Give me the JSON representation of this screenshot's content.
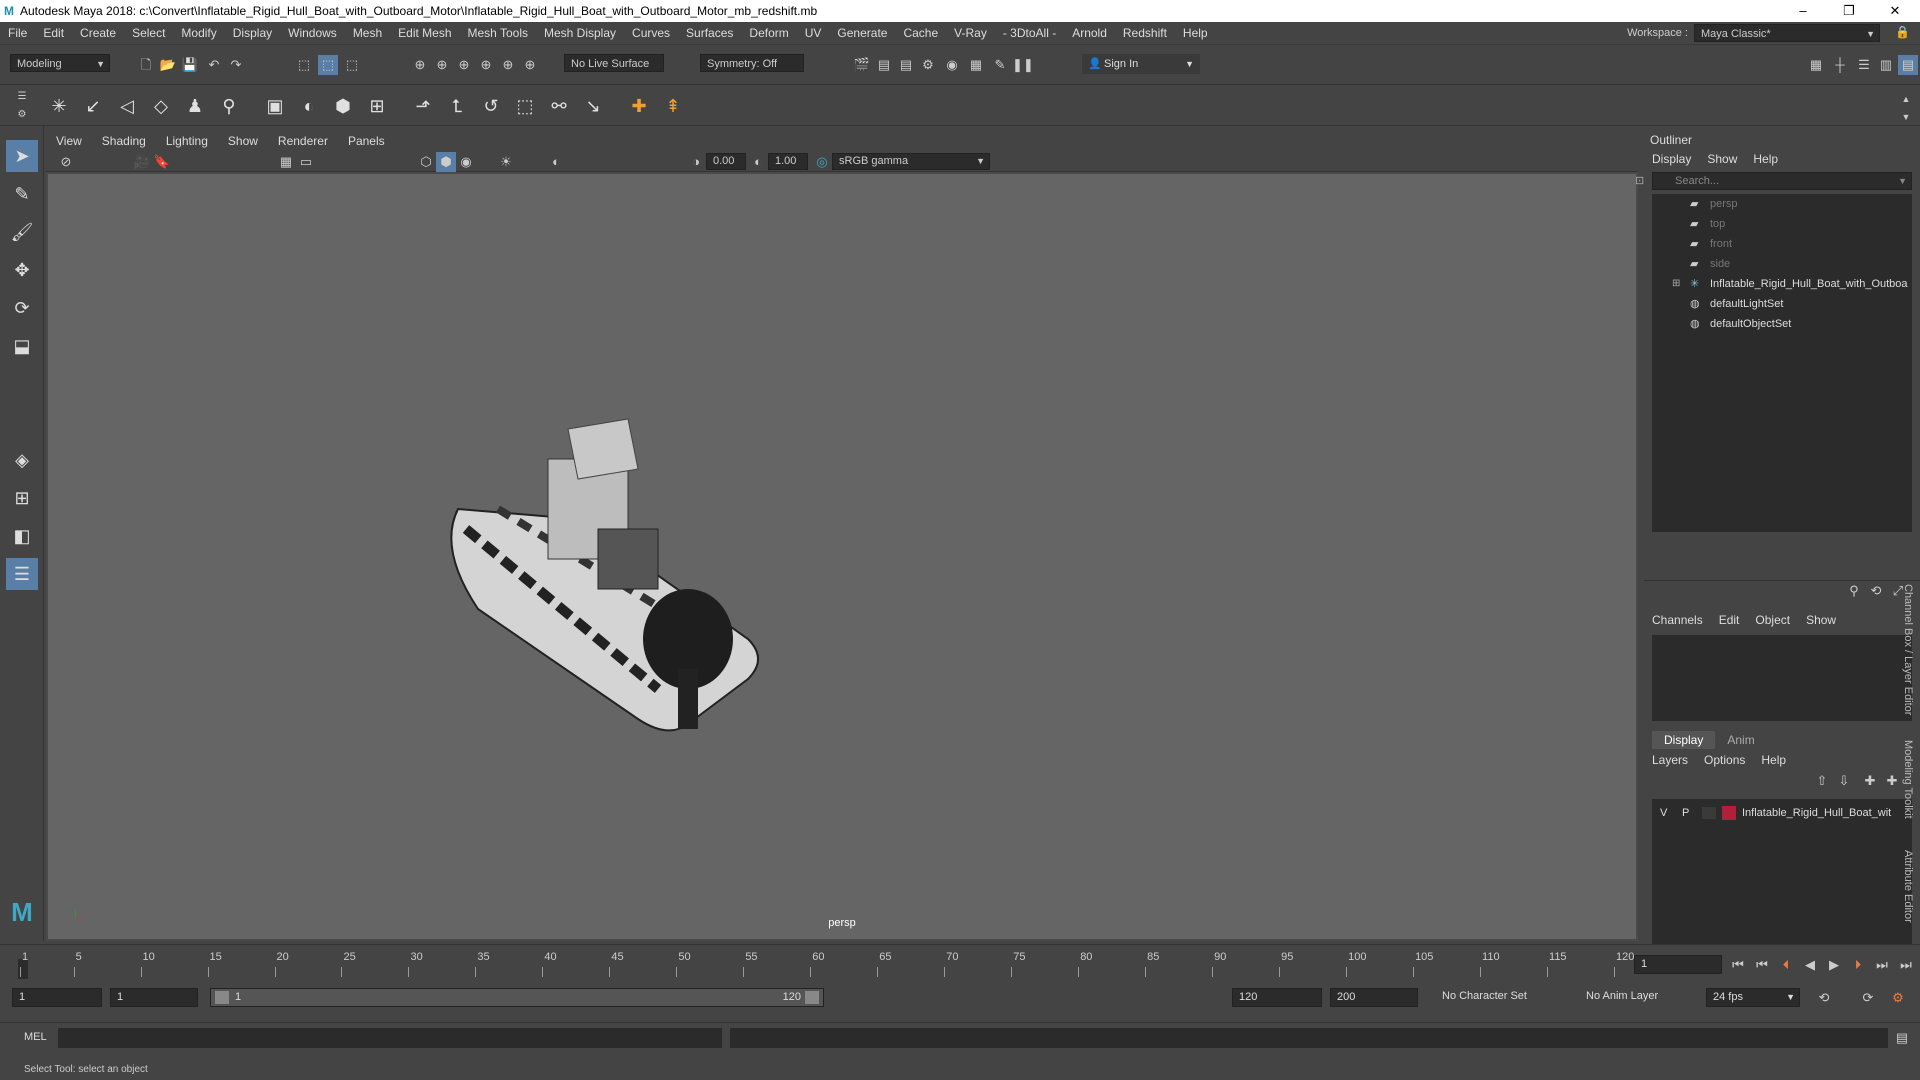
{
  "window": {
    "title": "Autodesk Maya 2018: c:\\Convert\\Inflatable_Rigid_Hull_Boat_with_Outboard_Motor\\Inflatable_Rigid_Hull_Boat_with_Outboard_Motor_mb_redshift.mb",
    "minimize": "–",
    "restore": "❐",
    "close": "✕"
  },
  "menubar": {
    "items": [
      "File",
      "Edit",
      "Create",
      "Select",
      "Modify",
      "Display",
      "Windows",
      "Mesh",
      "Edit Mesh",
      "Mesh Tools",
      "Mesh Display",
      "Curves",
      "Surfaces",
      "Deform",
      "UV",
      "Generate",
      "Cache",
      "V-Ray",
      "- 3DtoAll -",
      "Arnold",
      "Redshift",
      "Help"
    ],
    "workspace_label": "Workspace :",
    "workspace_value": "Maya Classic*"
  },
  "statusline": {
    "mode": "Modeling",
    "live_surface": "No Live Surface",
    "symmetry": "Symmetry: Off",
    "sign_in": "Sign In"
  },
  "viewport": {
    "menu": [
      "View",
      "Shading",
      "Lighting",
      "Show",
      "Renderer",
      "Panels"
    ],
    "exposure": "0.00",
    "gamma": "1.00",
    "color_space": "sRGB gamma",
    "camera_label": "persp"
  },
  "outliner": {
    "title": "Outliner",
    "menu": [
      "Display",
      "Show",
      "Help"
    ],
    "search_placeholder": "Search...",
    "items": [
      {
        "label": "persp",
        "icon": "camera-icon",
        "dim": true
      },
      {
        "label": "top",
        "icon": "camera-icon",
        "dim": true
      },
      {
        "label": "front",
        "icon": "camera-icon",
        "dim": true
      },
      {
        "label": "side",
        "icon": "camera-icon",
        "dim": true
      },
      {
        "label": "Inflatable_Rigid_Hull_Boat_with_Outboa",
        "icon": "group-icon",
        "dim": false
      },
      {
        "label": "defaultLightSet",
        "icon": "set-icon",
        "dim": false
      },
      {
        "label": "defaultObjectSet",
        "icon": "set-icon",
        "dim": false
      }
    ]
  },
  "channelbox": {
    "menu": [
      "Channels",
      "Edit",
      "Object",
      "Show"
    ],
    "tabs": [
      "Display",
      "Anim"
    ],
    "layer_menu": [
      "Layers",
      "Options",
      "Help"
    ],
    "layer": {
      "v": "V",
      "p": "P",
      "name": "Inflatable_Rigid_Hull_Boat_wit",
      "color": "#b0203a"
    },
    "side_tabs": [
      "Channel Box / Layer Editor",
      "Modeling Toolkit",
      "Attribute Editor"
    ]
  },
  "timeline": {
    "ticks": [
      "1",
      "5",
      "10",
      "15",
      "20",
      "25",
      "30",
      "35",
      "40",
      "45",
      "50",
      "55",
      "60",
      "65",
      "70",
      "75",
      "80",
      "85",
      "90",
      "95",
      "100",
      "105",
      "110",
      "115",
      "120"
    ],
    "current_frame": "1"
  },
  "range": {
    "start": "1",
    "playback_start": "1",
    "slider_start": "1",
    "slider_end": "120",
    "playback_end": "120",
    "end": "200",
    "character_set": "No Character Set",
    "anim_layer": "No Anim Layer",
    "fps": "24 fps"
  },
  "command": {
    "label": "MEL"
  },
  "help": {
    "text": "Select Tool: select an object"
  }
}
